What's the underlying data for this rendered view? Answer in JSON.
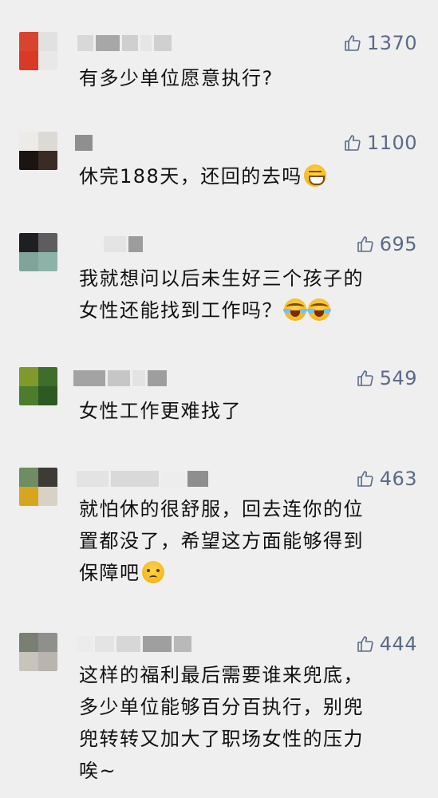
{
  "colors": {
    "background": "#efefef",
    "like_text": "#5a6a87",
    "comment_text": "#111111"
  },
  "icons": {
    "like": "thumbs-up-icon"
  },
  "comments": [
    {
      "likes": "1370",
      "text": "有多少单位愿意执行?",
      "emojis": []
    },
    {
      "likes": "1100",
      "text": "休完188天，还回的去吗",
      "emojis": [
        "grinning-sweat-emoji"
      ]
    },
    {
      "likes": "695",
      "line1": "我就想问以后未生好三个孩子的",
      "line2": "女性还能找到工作吗？",
      "emojis": [
        "crying-laughing-emoji",
        "crying-laughing-emoji"
      ]
    },
    {
      "likes": "549",
      "text": "女性工作更难找了",
      "emojis": []
    },
    {
      "likes": "463",
      "line1": "就怕休的很舒服，回去连你的位",
      "line2": "置都没了，希望这方面能够得到",
      "line3": "保障吧",
      "emojis": [
        "worried-emoji"
      ]
    },
    {
      "likes": "444",
      "line1": "这样的福利最后需要谁来兜底，",
      "line2": "多少单位能够百分百执行，别兜",
      "line3": "兜转转又加大了职场女性的压力",
      "line4": "唉~",
      "emojis": []
    }
  ]
}
